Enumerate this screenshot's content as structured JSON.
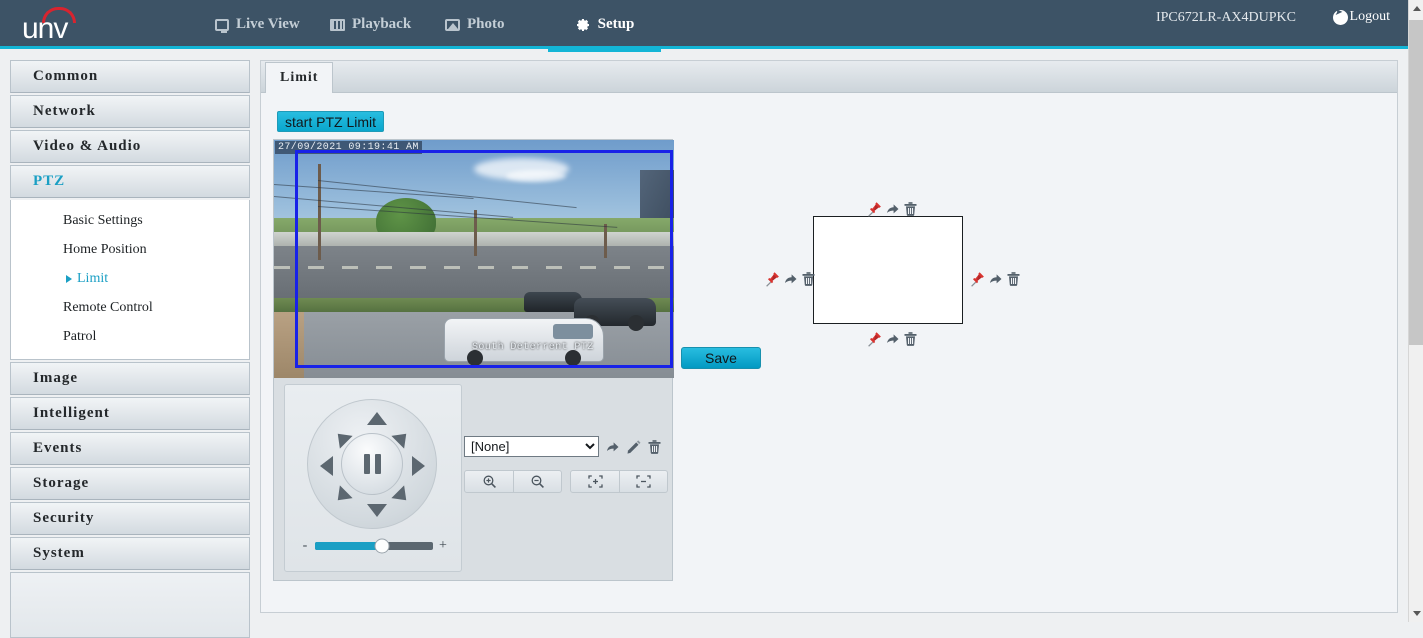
{
  "header": {
    "logo_text": "unv",
    "nav": [
      {
        "label": "Live View",
        "icon": "monitor-icon",
        "active": false
      },
      {
        "label": "Playback",
        "icon": "film-icon",
        "active": false
      },
      {
        "label": "Photo",
        "icon": "photo-icon",
        "active": false
      },
      {
        "label": "Setup",
        "icon": "gear-icon",
        "active": true
      }
    ],
    "device_name": "IPC672LR-AX4DUPKC",
    "logout_label": "Logout",
    "accent_color": "#13b5d6",
    "background_color": "#3d5366"
  },
  "sidebar": {
    "groups": [
      {
        "label": "Common"
      },
      {
        "label": "Network"
      },
      {
        "label": "Video & Audio"
      },
      {
        "label": "PTZ"
      }
    ],
    "ptz_submenu": [
      {
        "label": "Basic Settings"
      },
      {
        "label": "Home Position"
      },
      {
        "label": "Limit"
      },
      {
        "label": "Remote Control"
      },
      {
        "label": "Patrol"
      }
    ],
    "groups_lower": [
      {
        "label": "Image"
      },
      {
        "label": "Intelligent"
      },
      {
        "label": "Events"
      },
      {
        "label": "Storage"
      },
      {
        "label": "Security"
      },
      {
        "label": "System"
      }
    ],
    "active_group": "PTZ",
    "active_sub": "Limit"
  },
  "content": {
    "tab_label": "Limit",
    "start_button_label": "start PTZ Limit",
    "save_button_label": "Save"
  },
  "video": {
    "timestamp": "27/09/2021 09:19:41 AM",
    "camera_label": "South Deterrent PTZ",
    "limit_box_color": "#1822e8"
  },
  "ptz_controls": {
    "center_icon": "pause-icon",
    "arrows": [
      "up",
      "up-right",
      "right",
      "down-right",
      "down",
      "down-left",
      "left",
      "up-left"
    ],
    "speed_minus": "-",
    "speed_plus": "+",
    "speed_percent": 57,
    "preset_value": "[None]",
    "preset_options": [
      "[None]"
    ],
    "preset_actions": [
      {
        "name": "goto-preset-icon",
        "glyph": "arrow"
      },
      {
        "name": "edit-preset-icon",
        "glyph": "pencil"
      },
      {
        "name": "delete-preset-icon",
        "glyph": "trash"
      }
    ],
    "lens_buttons": [
      {
        "name": "zoom-in-button",
        "glyph": "magnifier-plus"
      },
      {
        "name": "zoom-out-button",
        "glyph": "magnifier-minus"
      },
      {
        "name": "focus-near-button",
        "glyph": "focus-plus"
      },
      {
        "name": "focus-far-button",
        "glyph": "focus-minus"
      }
    ]
  },
  "limit_diagram": {
    "sides": [
      "top",
      "left",
      "right",
      "bottom"
    ],
    "actions": [
      {
        "name": "set-limit-icon",
        "glyph": "pushpin",
        "color": "#d9332f"
      },
      {
        "name": "goto-limit-icon",
        "glyph": "arrow",
        "color": "#54606b"
      },
      {
        "name": "delete-limit-icon",
        "glyph": "trash",
        "color": "#54606b"
      }
    ]
  },
  "scrollbar": {
    "up_icon": "chevron-up-icon",
    "down_icon": "chevron-down-icon",
    "thumb_position": "top"
  }
}
